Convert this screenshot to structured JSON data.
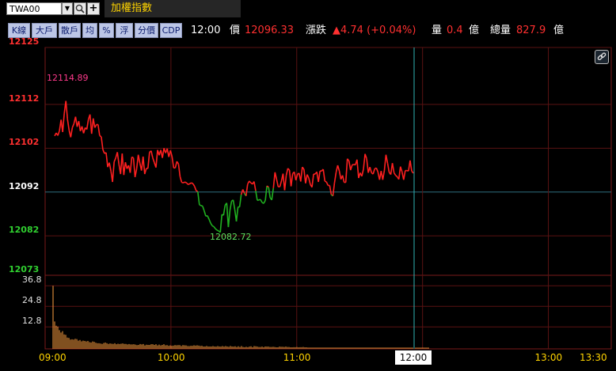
{
  "header": {
    "symbol": "TWA00",
    "name": "加權指數"
  },
  "toolbar": {
    "buttons": [
      "K線",
      "大戶",
      "散戶",
      "均",
      "%",
      "浮",
      "分價",
      "CDP"
    ]
  },
  "quote": {
    "time": "12:00",
    "price_label": "價",
    "price": "12096.33",
    "change_label": "漲跌",
    "change": "▲4.74 (+0.04%)",
    "vol_label": "量",
    "vol": "0.4",
    "vol_unit": "億",
    "total_label": "總量",
    "total": "827.9",
    "total_unit": "億"
  },
  "axis": {
    "price_ticks": [
      {
        "label": "12125",
        "value": 12125,
        "color": "#ff3030"
      },
      {
        "label": "12112",
        "value": 12112,
        "color": "#ff3030"
      },
      {
        "label": "12102",
        "value": 12102,
        "color": "#ff3030"
      },
      {
        "label": "12092",
        "value": 12092,
        "color": "#ffffff"
      },
      {
        "label": "12082",
        "value": 12082,
        "color": "#30d030"
      },
      {
        "label": "12073",
        "value": 12073,
        "color": "#30d030"
      }
    ],
    "volume_ticks": [
      "36.8",
      "24.8",
      "12.8"
    ],
    "time_ticks": [
      "09:00",
      "10:00",
      "11:00",
      "12:00",
      "13:00",
      "13:30"
    ],
    "cursor_time": "12:00"
  },
  "annotations": {
    "high": "12114.89",
    "low": "12082.72"
  },
  "chart_data": {
    "type": "line",
    "reference_price": 12092,
    "ylim": [
      12073,
      12125
    ],
    "prices": [
      12104.8,
      12105.5,
      12104.9,
      12106.0,
      12108.5,
      12105.7,
      12110.0,
      12112.8,
      12108.6,
      12106.1,
      12104.5,
      12106.7,
      12107.6,
      12109.2,
      12106.9,
      12108.2,
      12105.9,
      12107.0,
      12105.4,
      12106.7,
      12106.3,
      12108.6,
      12109.7,
      12105.3,
      12108.8,
      12106.7,
      12107.4,
      12107.4,
      12104.9,
      12104.6,
      12101.7,
      12100.8,
      12101.0,
      12097.7,
      12098.7,
      12096.8,
      12094.3,
      12098.9,
      12099.8,
      12101.1,
      12098.3,
      12096.1,
      12100.8,
      12095.9,
      12098.8,
      12097.3,
      12098.1,
      12096.4,
      12100.0,
      12099.8,
      12095.4,
      12097.3,
      12100.5,
      12098.6,
      12096.9,
      12100.1,
      12096.1,
      12097.4,
      12097.4,
      12101.1,
      12101.4,
      12099.8,
      12098.7,
      12097.6,
      12101.6,
      12100.4,
      12101.6,
      12099.8,
      12102.0,
      12100.9,
      12101.9,
      12100.0,
      12101.5,
      12100.1,
      12097.5,
      12097.5,
      12099.0,
      12098.4,
      12095.5,
      12094.2,
      12094.1,
      12094.3,
      12094.1,
      12093.7,
      12093.9,
      12094.1,
      12093.9,
      12093.3,
      12092.3,
      12092.1,
      12089.1,
      12088.9,
      12088.8,
      12087.7,
      12086.5,
      12086.6,
      12085.8,
      12084.9,
      12084.3,
      12084.1,
      12083.6,
      12083.3,
      12083.1,
      12082.8,
      12086.9,
      12086.7,
      12089.0,
      12089.5,
      12084.0,
      12087.8,
      12089.9,
      12090.2,
      12088.0,
      12085.3,
      12088.6,
      12088.6,
      12091.4,
      12092.6,
      12091.7,
      12091.1,
      12093.8,
      12094.5,
      12094.1,
      12093.8,
      12094.4,
      12092.3,
      12090.1,
      12090.2,
      12090.3,
      12089.6,
      12089.4,
      12090.1,
      12093.4,
      12093.1,
      12090.7,
      12090.2,
      12092.9,
      12096.5,
      12094.9,
      12093.2,
      12093.2,
      12094.5,
      12096.2,
      12092.4,
      12095.8,
      12097.4,
      12097.0,
      12093.3,
      12096.2,
      12096.6,
      12094.7,
      12096.1,
      12096.3,
      12094.4,
      12097.7,
      12097.2,
      12094.0,
      12096.0,
      12095.2,
      12093.7,
      12093.1,
      12096.1,
      12096.1,
      12096.6,
      12094.3,
      12096.8,
      12096.8,
      12097.2,
      12094.5,
      12094.3,
      12093.5,
      12093.5,
      12091.4,
      12091.1,
      12094.1,
      12096.5,
      12098.1,
      12096.8,
      12094.9,
      12095.8,
      12094.2,
      12094.2,
      12099.6,
      12099.1,
      12097.0,
      12098.2,
      12098.3,
      12098.2,
      12099.4,
      12095.2,
      12096.4,
      12095.6,
      12097.2,
      12100.7,
      12099.6,
      12096.4,
      12097.7,
      12096.4,
      12096.1,
      12097.3,
      12097.5,
      12096.6,
      12094.8,
      12096.8,
      12094.8,
      12096.9,
      12100.5,
      12098.6,
      12096.5,
      12096.0,
      12098.6,
      12096.4,
      12095.8,
      12095.5,
      12094.9,
      12097.8,
      12096.6,
      12094.8,
      12096.9,
      12096.9,
      12096.8,
      12099.2,
      12096.8,
      12096.3
    ],
    "volume_ylim": [
      0,
      42
    ],
    "volumes": [
      36.8,
      16.0,
      13.5,
      13.0,
      10.9,
      9.5,
      10.3,
      8.4,
      8.2,
      6.6,
      6.4,
      5.4,
      5.6,
      5.4,
      5.9,
      5.7,
      4.8,
      5.2,
      4.4,
      4.8,
      4.6,
      4.3,
      4.6,
      3.9,
      3.7,
      4.3,
      4.1,
      3.6,
      3.3,
      3.3,
      3.1,
      2.9,
      3.4,
      3.7,
      3.3,
      2.9,
      3.2,
      3.0,
      2.9,
      3.3,
      2.7,
      3.0,
      2.8,
      3.0,
      3.2,
      2.9,
      2.9,
      2.6,
      2.8,
      2.6,
      2.6,
      2.7,
      2.5,
      2.2,
      2.3,
      2.8,
      2.6,
      2.8,
      2.0,
      2.4,
      2.3,
      2.3,
      2.7,
      2.7,
      2.3,
      2.7,
      2.0,
      2.5,
      2.0,
      2.3,
      2.7,
      2.1,
      2.2,
      1.8,
      2.0,
      1.8,
      1.9,
      2.2,
      2.1,
      2.2,
      2.2,
      1.7,
      2.2,
      2.1,
      2.0,
      1.7,
      1.6,
      1.8,
      1.8,
      2.1,
      1.9,
      2.1,
      1.9,
      1.7,
      1.8,
      1.4,
      1.4,
      1.7,
      1.4,
      1.4,
      1.4,
      1.6,
      1.4,
      1.3,
      1.6,
      1.4,
      1.3,
      1.6,
      1.3,
      1.6,
      1.4,
      1.2,
      1.7,
      1.4,
      1.3,
      1.5,
      1.1,
      1.5,
      1.1,
      1.6,
      1.1,
      1.0,
      1.2,
      1.0,
      1.3,
      1.5,
      1.0,
      1.6,
      1.5,
      1.3,
      1.1,
      1.1,
      1.3,
      1.0,
      1.4,
      1.3,
      1.3,
      1.1,
      1.1,
      1.2,
      1.1,
      0.9,
      0.9,
      1.3,
      1.2,
      1.2,
      1.1,
      1.3,
      1.1,
      1.1,
      0.9,
      0.9,
      1.0,
      1.0,
      1.1,
      0.9,
      1.0,
      1.0,
      1.1,
      0.9,
      0.9,
      0.8,
      0.8,
      0.8,
      0.8,
      0.8,
      0.8,
      0.8,
      0.8,
      0.8,
      0.8,
      0.8,
      0.8,
      0.8,
      0.8,
      0.8,
      0.8,
      0.8,
      0.8,
      0.8,
      0.8,
      0.8,
      0.8,
      0.8,
      0.8,
      0.8,
      0.8,
      0.8,
      0.8,
      0.8,
      0.8,
      0.8,
      0.8,
      0.8,
      0.8,
      0.8,
      0.8,
      0.8,
      0.8,
      0.8,
      0.8,
      0.8,
      0.8,
      0.8,
      0.8,
      0.8,
      0.8,
      0.8,
      0.8,
      0.8,
      0.8,
      0.8,
      0.8,
      0.8,
      0.8,
      0.8,
      0.8,
      0.8,
      0.8,
      0.8,
      0.8,
      0.8,
      0.8,
      0.8,
      0.8,
      0.8,
      0.8,
      0.8,
      0.8,
      0.8,
      0.8,
      0.8,
      0.8,
      0.8,
      0.8,
      0.8,
      0.8,
      0.8
    ]
  }
}
